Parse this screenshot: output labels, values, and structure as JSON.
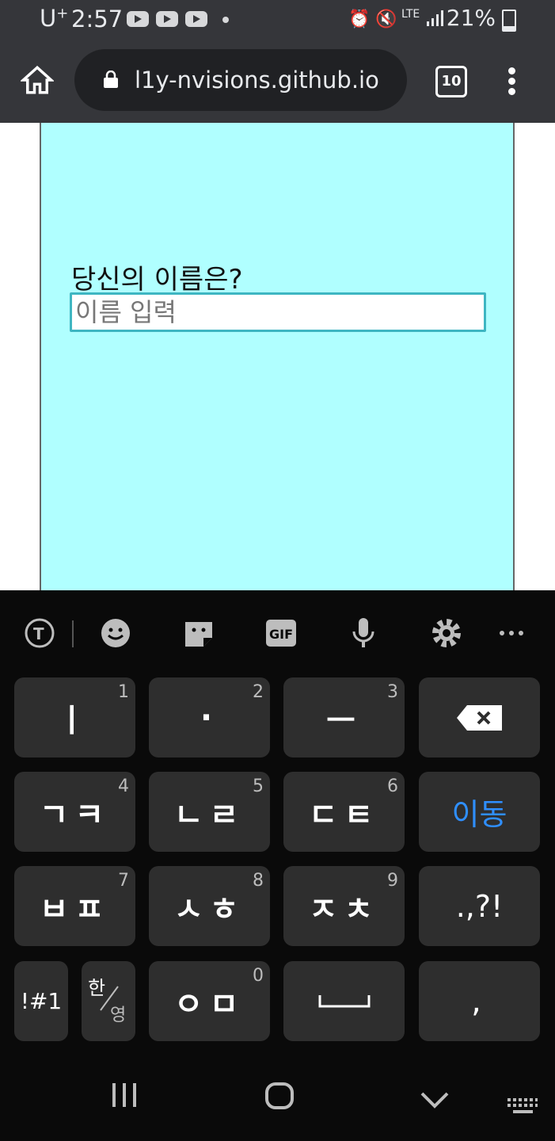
{
  "status_bar": {
    "carrier": "U",
    "carrier_sup": "+",
    "time": "2:57",
    "network": "LTE",
    "battery": "21%"
  },
  "browser": {
    "url": "l1y-nvisions.github.io",
    "tab_count": "10"
  },
  "page": {
    "question": "당신의 이름은?",
    "input_placeholder": "이름 입력",
    "input_value": "",
    "background_color": "#b0ffff"
  },
  "keyboard": {
    "rows": [
      [
        {
          "label": "ㅣ",
          "num": "1"
        },
        {
          "label": "·",
          "num": "2"
        },
        {
          "label": "ㅡ",
          "num": "3"
        },
        {
          "label": "backspace"
        }
      ],
      [
        {
          "label": "ㄱㅋ",
          "num": "4"
        },
        {
          "label": "ㄴㄹ",
          "num": "5"
        },
        {
          "label": "ㄷㅌ",
          "num": "6"
        },
        {
          "label": "이동"
        }
      ],
      [
        {
          "label": "ㅂㅍ",
          "num": "7"
        },
        {
          "label": "ㅅㅎ",
          "num": "8"
        },
        {
          "label": "ㅈㅊ",
          "num": "9"
        },
        {
          "label": ".,?!"
        }
      ]
    ],
    "bottom_row": {
      "symbols": "!#1",
      "lang_top": "한",
      "lang_bottom": "영",
      "o_m": "ㅇㅁ",
      "o_m_num": "0",
      "comma": ","
    },
    "toolbar_icons": [
      "translate-icon",
      "emoji-icon",
      "sticker-icon",
      "gif-icon",
      "mic-icon",
      "settings-icon",
      "more-icon"
    ],
    "gif_label": "GIF"
  },
  "colors": {
    "toolbar": "#35363a",
    "accent_blue": "#2f8fff"
  }
}
